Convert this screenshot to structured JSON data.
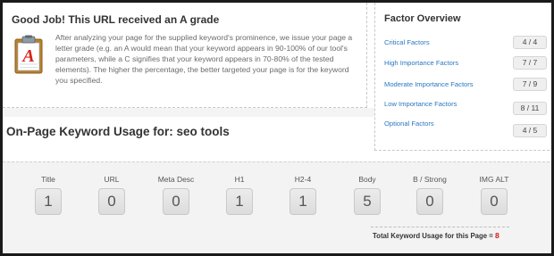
{
  "grade": {
    "title": "Good Job! This URL received an A grade",
    "icon": "clipboard-grade-icon",
    "icon_letter": "A",
    "icon_letter_color": "#d9241c",
    "description": "After analyzing your page for the supplied keyword's prominence, we issue your page a letter grade (e.g. an A would mean that your keyword appears in 90-100% of our tool's parameters, while a C signifies that your keyword appears in 70-80% of the tested elements). The higher the percentage, the better targeted your page is for the keyword you specified."
  },
  "factor_overview": {
    "title": "Factor Overview",
    "link_color": "#2a78c2",
    "factors": [
      {
        "label": "Critical Factors",
        "value": "4 / 4"
      },
      {
        "label": "High Importance Factors",
        "value": "7 / 7"
      },
      {
        "label": "Moderate Importance Factors",
        "value": "7 / 9"
      },
      {
        "label": "Low Importance Factors",
        "value": "8 / 11"
      },
      {
        "label": "Optional Factors",
        "value": "4 / 5"
      }
    ]
  },
  "keyword_usage": {
    "heading": "On-Page Keyword Usage for: seo tools",
    "metrics": [
      {
        "label": "Title",
        "value": "1"
      },
      {
        "label": "URL",
        "value": "0"
      },
      {
        "label": "Meta Desc",
        "value": "0"
      },
      {
        "label": "H1",
        "value": "1"
      },
      {
        "label": "H2-4",
        "value": "1"
      },
      {
        "label": "Body",
        "value": "5"
      },
      {
        "label": "B / Strong",
        "value": "0"
      },
      {
        "label": "IMG ALT",
        "value": "0"
      }
    ],
    "total_label": "Total Keyword Usage for this Page = ",
    "total_value": "8",
    "total_color": "#d11a1a"
  }
}
